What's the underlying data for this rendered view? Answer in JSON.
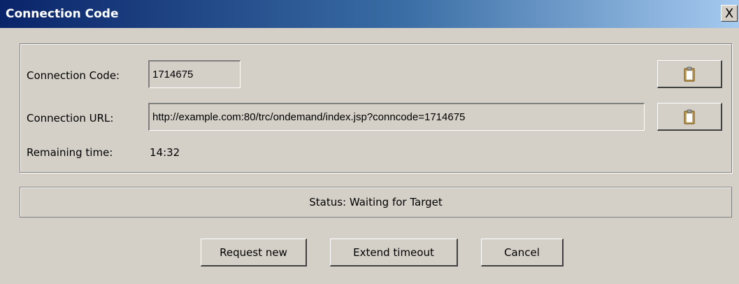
{
  "window": {
    "title": "Connection Code",
    "close_label": "X"
  },
  "form": {
    "code_label": "Connection Code:",
    "code_value": "1714675",
    "url_label": "Connection URL:",
    "url_value": "http://example.com:80/trc/ondemand/index.jsp?conncode=1714675",
    "remaining_label": "Remaining time:",
    "remaining_value": "14:32"
  },
  "icons": {
    "copy_code": "clipboard-icon",
    "copy_url": "clipboard-icon"
  },
  "status": {
    "text": "Status: Waiting for Target"
  },
  "buttons": {
    "request_new": "Request new",
    "extend_timeout": "Extend timeout",
    "cancel": "Cancel"
  }
}
